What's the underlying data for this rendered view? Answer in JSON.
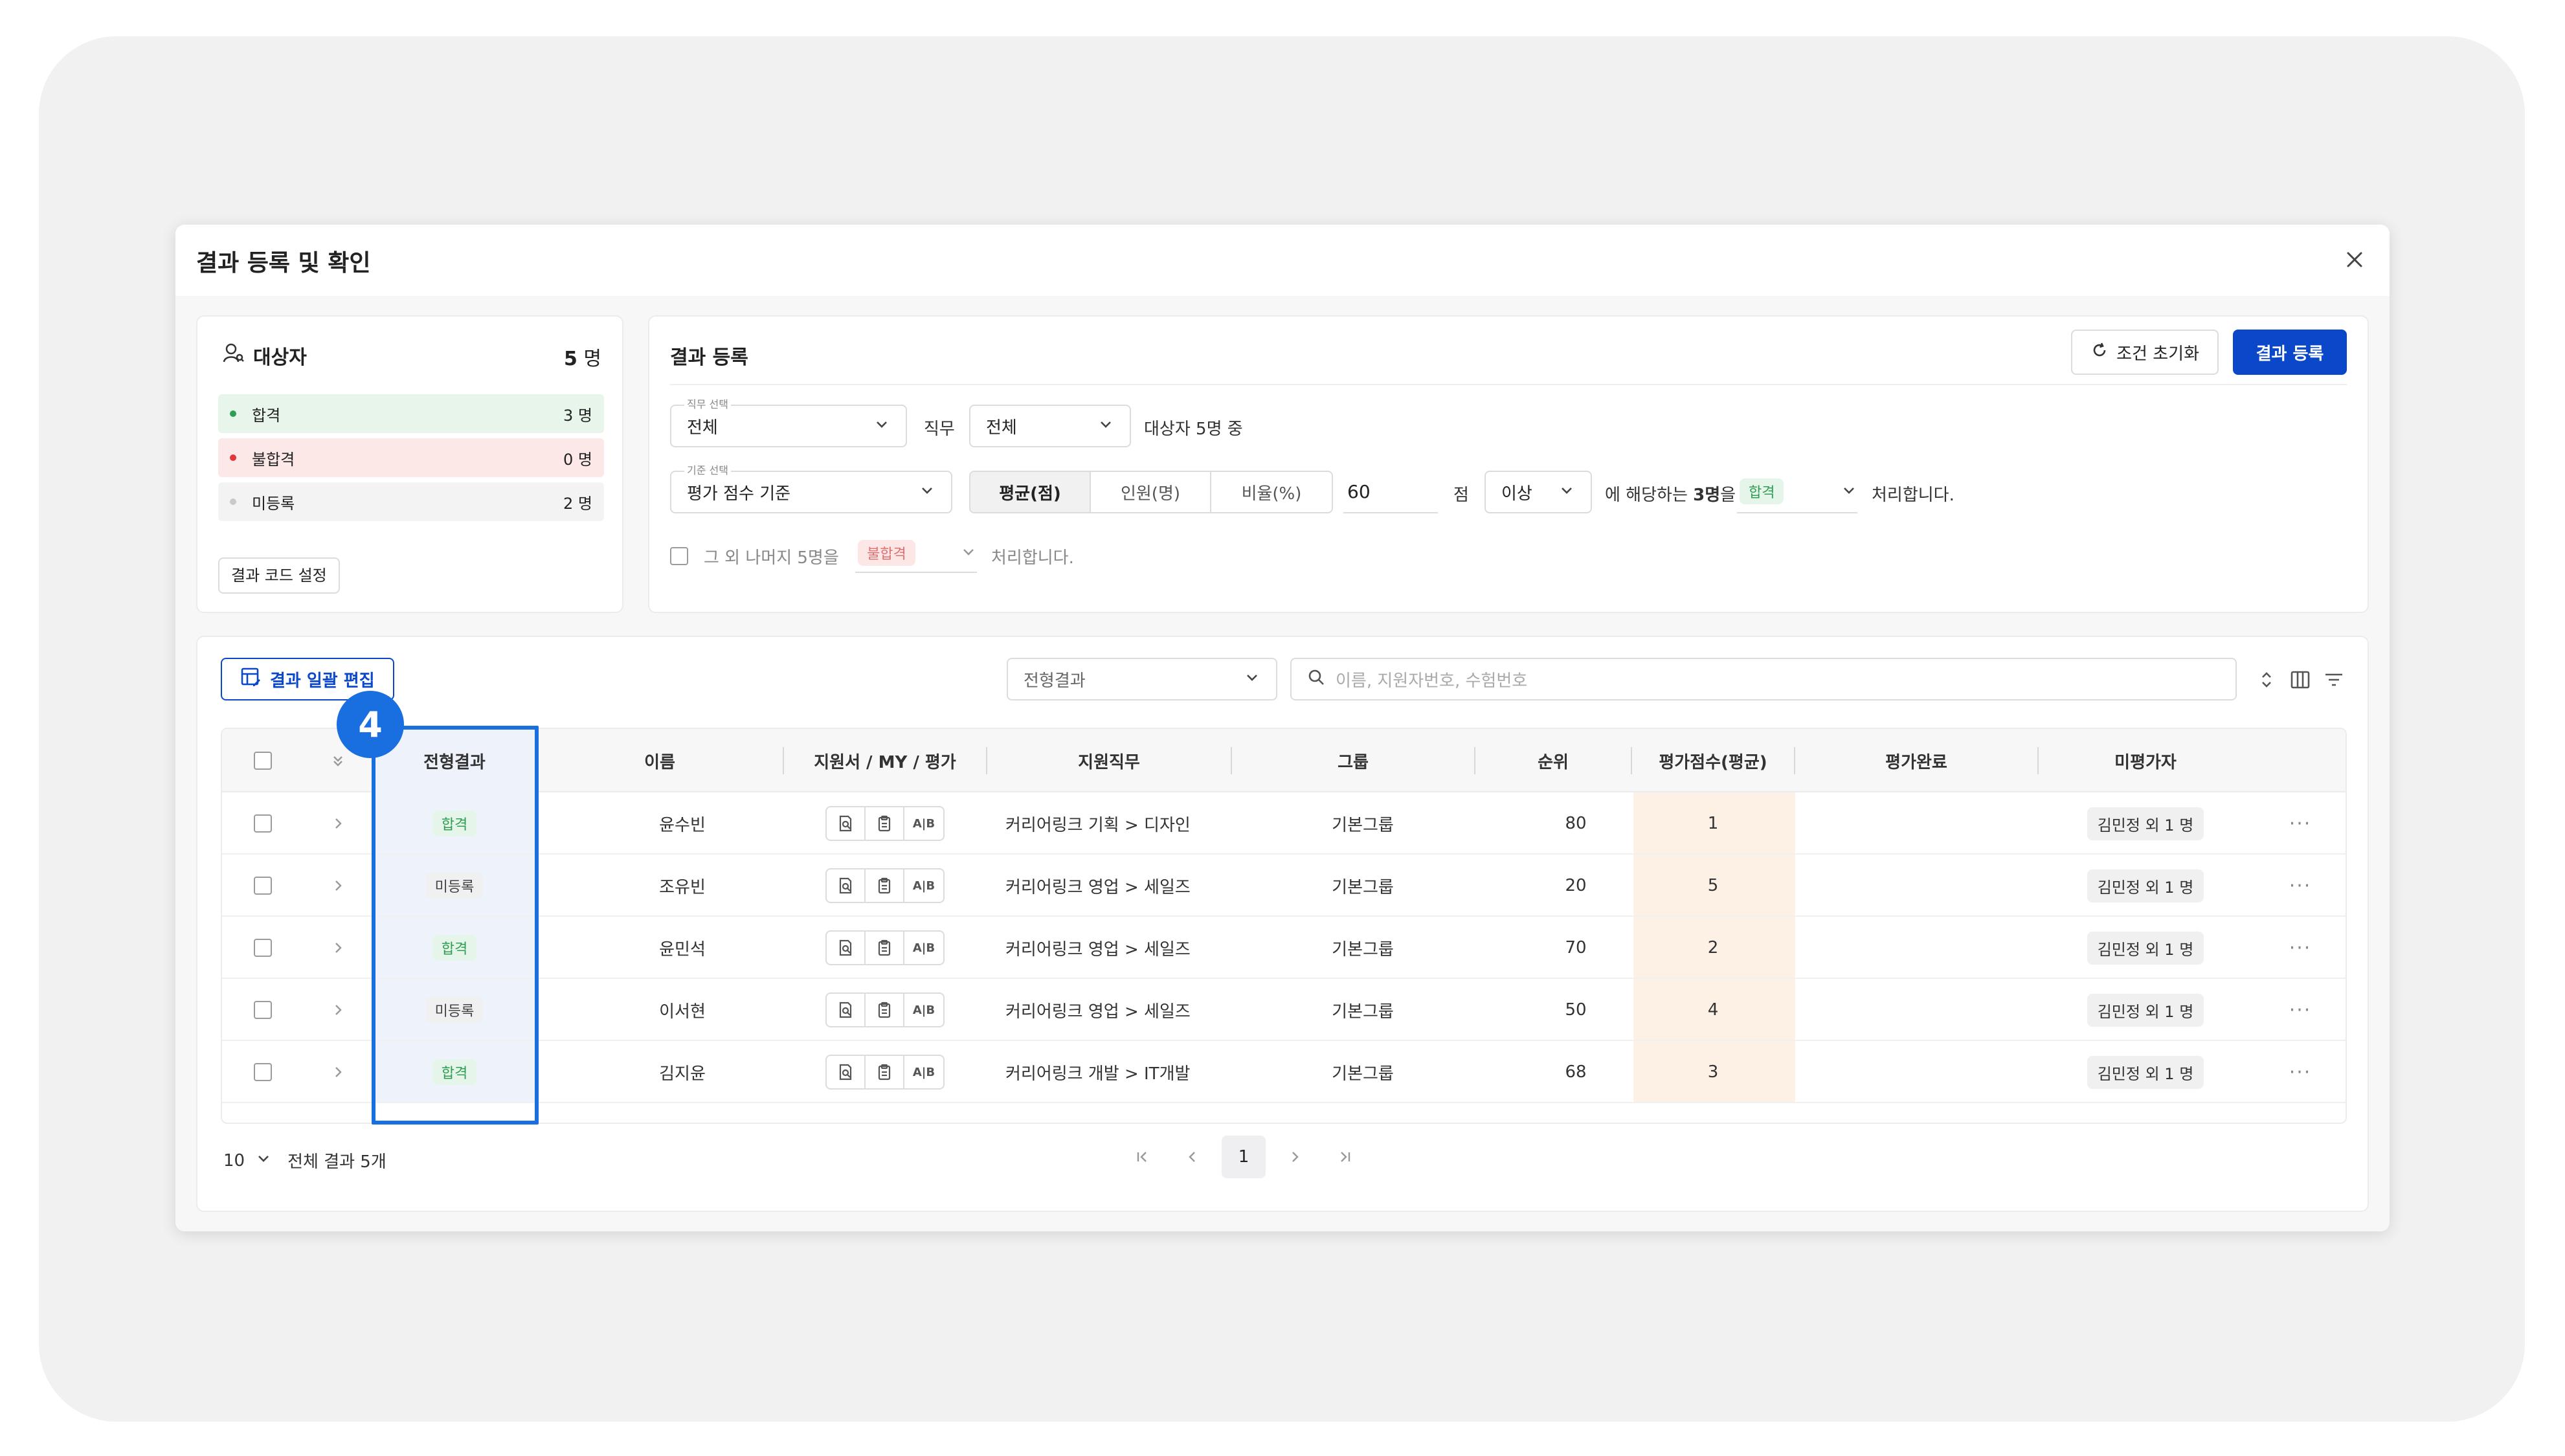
{
  "modal": {
    "title": "결과 등록 및 확인"
  },
  "target": {
    "title": "대상자",
    "count": "5",
    "unit": "명",
    "rows": [
      {
        "label": "합격",
        "count": "3 명",
        "bg": "#e8f5ea",
        "dot": "#2e9e52"
      },
      {
        "label": "불합격",
        "count": "0 명",
        "bg": "#fde8e8",
        "dot": "#e03838"
      },
      {
        "label": "미등록",
        "count": "2 명",
        "bg": "#f3f3f4",
        "dot": "#c9c9cc"
      }
    ],
    "code_button": "결과 코드 설정"
  },
  "register": {
    "title": "결과 등록",
    "reset_button": "조건 초기화",
    "submit_button": "결과 등록",
    "job_select": {
      "label": "직무 선택",
      "value": "전체"
    },
    "job_word": "직무",
    "job_value": "전체",
    "target_text": "대상자 5명 중",
    "criteria_select": {
      "label": "기준 선택",
      "value": "평가 점수 기준"
    },
    "segments": [
      "평균(점)",
      "인원(명)",
      "비율(%)"
    ],
    "score_value": "60",
    "score_unit": "점",
    "compare_value": "이상",
    "apply_prefix": "에 해당하는 ",
    "apply_count": "3명",
    "apply_suffix": "을",
    "pass_pill": "합격",
    "process_text": "처리합니다.",
    "rest_text": "그 외 나머지 5명을",
    "fail_pill": "불합격",
    "rest_process_text": "처리합니다."
  },
  "table": {
    "bulk_button": "결과 일괄 편집",
    "filter_placeholder": "전형결과",
    "search_placeholder": "이름, 지원자번호, 수험번호",
    "headers": {
      "result": "전형결과",
      "name": "이름",
      "docs": "지원서 / MY / 평가",
      "job": "지원직무",
      "group": "그룹",
      "rank": "순위",
      "score": "평가점수(평균)",
      "done": "평가완료",
      "pending": "미평가자"
    },
    "rows": [
      {
        "result": "합격",
        "type": "pass",
        "name": "윤수빈",
        "job": "커리어링크 기획 > 디자인",
        "group": "기본그룹",
        "rank": "80",
        "score": "1",
        "pending": "김민정 외 1 명"
      },
      {
        "result": "미등록",
        "type": "none",
        "name": "조유빈",
        "job": "커리어링크 영업 > 세일즈",
        "group": "기본그룹",
        "rank": "20",
        "score": "5",
        "pending": "김민정 외 1 명"
      },
      {
        "result": "합격",
        "type": "pass",
        "name": "윤민석",
        "job": "커리어링크 영업 > 세일즈",
        "group": "기본그룹",
        "rank": "70",
        "score": "2",
        "pending": "김민정 외 1 명"
      },
      {
        "result": "미등록",
        "type": "none",
        "name": "이서현",
        "job": "커리어링크 영업 > 세일즈",
        "group": "기본그룹",
        "rank": "50",
        "score": "4",
        "pending": "김민정 외 1 명"
      },
      {
        "result": "합격",
        "type": "pass",
        "name": "김지윤",
        "job": "커리어링크 개발 > IT개발",
        "group": "기본그룹",
        "rank": "68",
        "score": "3",
        "pending": "김민정 외 1 명"
      }
    ],
    "doc_ab_label": "A|B",
    "more": "···",
    "page_size": "10",
    "total_text": "전체 결과 5개",
    "current_page": "1"
  },
  "annotation": {
    "step": "4"
  }
}
